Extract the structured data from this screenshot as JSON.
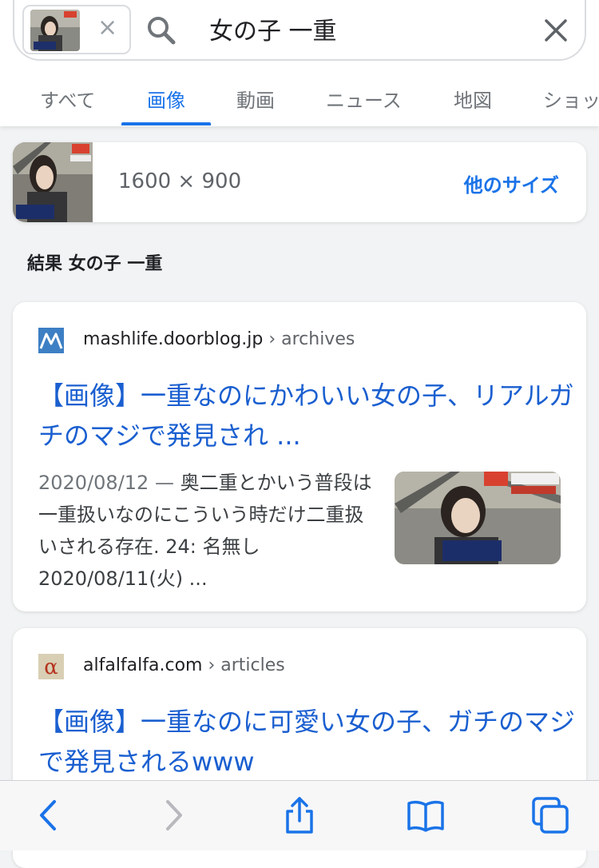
{
  "search": {
    "query": "女の子 一重",
    "chip_close": "×"
  },
  "tabs": [
    {
      "label": "すべて",
      "active": false
    },
    {
      "label": "画像",
      "active": true
    },
    {
      "label": "動画",
      "active": false
    },
    {
      "label": "ニュース",
      "active": false
    },
    {
      "label": "地図",
      "active": false
    },
    {
      "label": "ショッ",
      "active": false
    }
  ],
  "image_info": {
    "dimensions": "1600 × 900",
    "more_sizes": "他のサイズ"
  },
  "results_heading": "結果 女の子 一重",
  "results": [
    {
      "domain": "mashlife.doorblog.jp",
      "path": " › archives",
      "title": "【画像】一重なのにかわいい女の子、リアルガチのマジで発見され ...",
      "date": "2020/08/12",
      "separator": " — ",
      "snippet": "奥二重とかいう普段は一重扱いなのにこういう時だけ二重扱いされる存在. 24: 名無し 2020/08/11(火) ..."
    },
    {
      "domain": "alfalfalfa.com",
      "path": " › articles",
      "title": "【画像】一重なのに可愛い女の子、ガチのマジで発見されるwww",
      "favicon_letter": "α"
    }
  ],
  "colors": {
    "accent": "#1a73e8",
    "link": "#1a5fd0",
    "tab_inactive": "#70757a"
  }
}
